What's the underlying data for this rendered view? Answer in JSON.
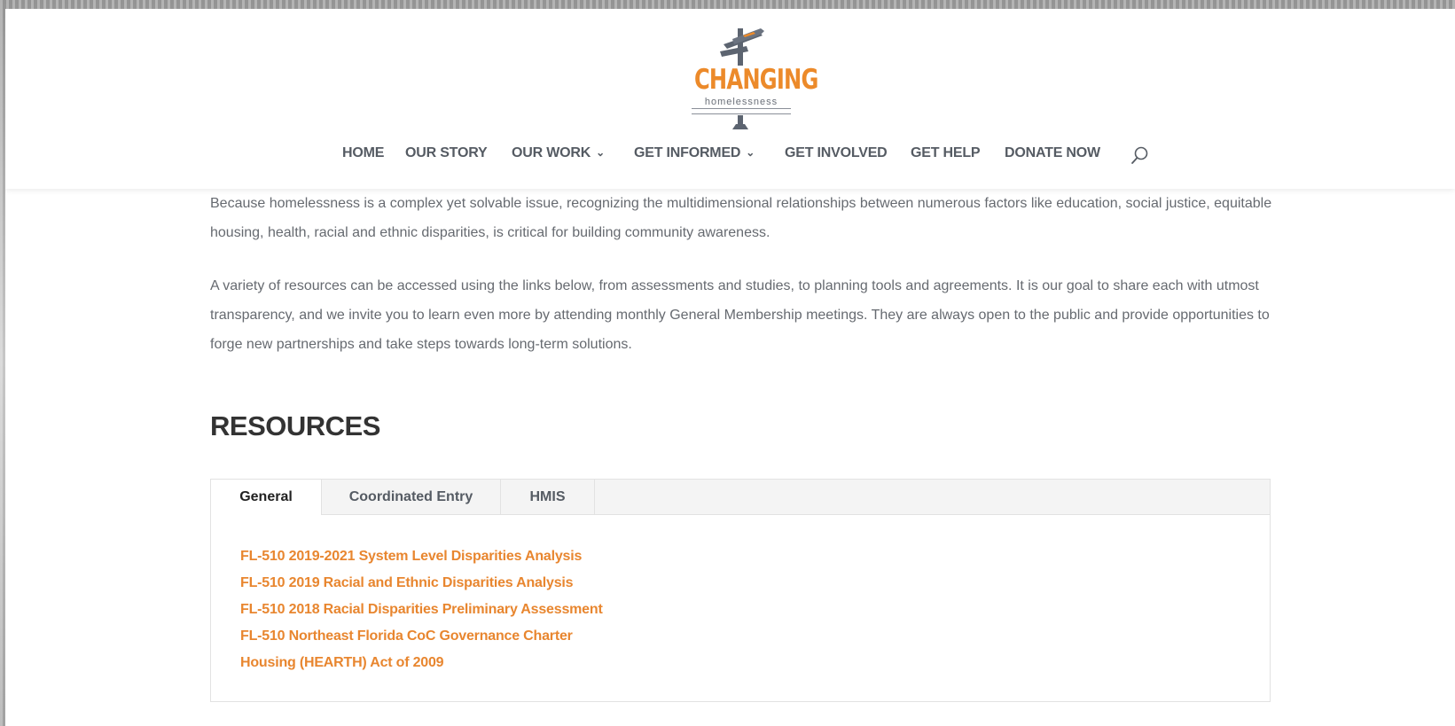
{
  "logo": {
    "wordmark": "CHANGING",
    "tagline": "homelessness"
  },
  "nav": {
    "items": [
      {
        "label": "HOME"
      },
      {
        "label": "OUR STORY"
      },
      {
        "label": "OUR WORK"
      },
      {
        "label": "GET INFORMED"
      },
      {
        "label": "GET INVOLVED"
      },
      {
        "label": "GET HELP"
      },
      {
        "label": "DONATE NOW"
      }
    ],
    "search_icon": "search-icon"
  },
  "intro": {
    "paragraph1": "Because homelessness is a complex yet solvable issue, recognizing the multidimensional relationships between numerous factors like education, social justice, equitable housing, health, racial and ethnic disparities, is critical for building community awareness.",
    "paragraph2": "A variety of resources can be accessed using the links below, from assessments and studies, to planning tools and agreements. It is our goal to share each with utmost transparency, and we invite you to learn even more by attending monthly General Membership meetings. They are always open to the public and provide opportunities to forge new partnerships and take steps towards long-term solutions."
  },
  "resources": {
    "heading": "RESOURCES",
    "tabs": [
      {
        "label": "General",
        "active": true
      },
      {
        "label": "Coordinated Entry",
        "active": false
      },
      {
        "label": "HMIS",
        "active": false
      }
    ],
    "links": [
      "FL-510 2019-2021 System Level Disparities Analysis",
      "FL-510 2019 Racial and Ethnic Disparities Analysis",
      "FL-510 2018 Racial Disparities Preliminary Assessment",
      "FL-510 Northeast Florida CoC Governance Charter",
      "Housing (HEARTH) Act of 2009"
    ]
  },
  "colors": {
    "accent": "#ec8a2a",
    "link": "#e8862f",
    "nav_text": "#555b63",
    "body_text": "#666a70"
  }
}
